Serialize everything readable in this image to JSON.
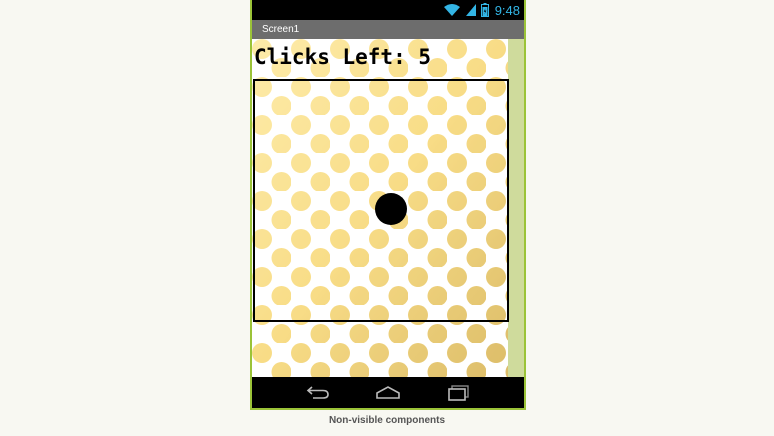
{
  "status_bar": {
    "time": "9:48",
    "icons": [
      "wifi-icon",
      "signal-icon",
      "battery-icon"
    ],
    "accent_color": "#33b5e5"
  },
  "title_bar": {
    "title": "Screen1"
  },
  "screen": {
    "clicks_label": "Clicks Left: 5",
    "background_pattern": "yellow-polka-dots",
    "dot_colors": [
      "#fde89a",
      "#f4d166",
      "#d9b34c"
    ]
  },
  "nav_bar": {
    "icons": [
      "back-icon",
      "home-icon",
      "recent-apps-icon"
    ]
  },
  "footer": {
    "non_visible_label": "Non-visible components"
  },
  "colors": {
    "frame_border": "#9bc338",
    "title_bar": "#6d6d6d",
    "side_strip": "#cfdb9c"
  }
}
